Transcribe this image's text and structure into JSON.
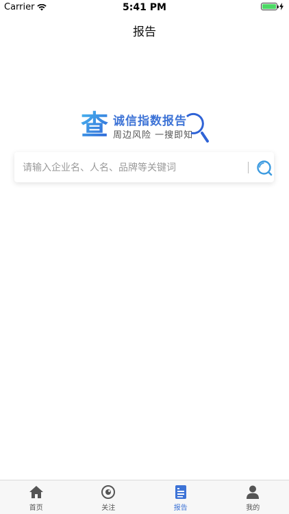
{
  "status_bar": {
    "carrier": "Carrier",
    "time": "5:41 PM",
    "battery_color": "#4cd964"
  },
  "nav": {
    "title": "报告"
  },
  "logo": {
    "char": "查",
    "title": "诚信指数报告",
    "subtitle": "周边风险 一搜即知"
  },
  "search": {
    "placeholder": "请输入企业名、人名、品牌等关键词",
    "value": "",
    "icon": "search-icon"
  },
  "tabbar": {
    "accent_color": "#3d73d6",
    "items": [
      {
        "label": "首页",
        "icon": "home-icon",
        "active": false
      },
      {
        "label": "关注",
        "icon": "eye-icon",
        "active": false
      },
      {
        "label": "报告",
        "icon": "report-icon",
        "active": true
      },
      {
        "label": "我的",
        "icon": "person-icon",
        "active": false
      }
    ]
  }
}
